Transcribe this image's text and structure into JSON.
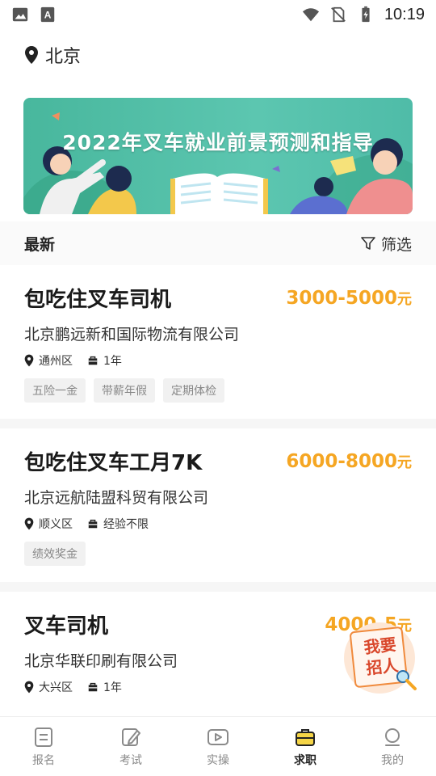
{
  "status_bar": {
    "time": "10:19",
    "icons": [
      "image-icon",
      "text-a-icon",
      "wifi-icon",
      "no-sim-icon",
      "battery-charging-icon"
    ]
  },
  "location": {
    "city": "北京",
    "icon": "location-pin-icon"
  },
  "banner": {
    "title": "2022年叉车就业前景预测和指导"
  },
  "feed": {
    "title": "最新",
    "filter_label": "筛选"
  },
  "jobs": [
    {
      "title": "包吃住叉车司机",
      "salary": "3000-5000",
      "unit": "元",
      "company": "北京鹏远新和国际物流有限公司",
      "district": "通州区",
      "experience": "1年",
      "tags": [
        "五险一金",
        "带薪年假",
        "定期体检"
      ]
    },
    {
      "title": "包吃住叉车工月7K",
      "salary": "6000-8000",
      "unit": "元",
      "company": "北京远航陆盟科贸有限公司",
      "district": "顺义区",
      "experience": "经验不限",
      "tags": [
        "绩效奖金"
      ]
    },
    {
      "title": "叉车司机",
      "salary": "4000-5",
      "unit": "元",
      "company": "北京华联印刷有限公司",
      "district": "大兴区",
      "experience": "1年",
      "tags": []
    }
  ],
  "fab": {
    "label_line1": "我要",
    "label_line2": "招人"
  },
  "tabs": [
    {
      "label": "报名",
      "icon": "form-icon"
    },
    {
      "label": "考试",
      "icon": "pencil-icon"
    },
    {
      "label": "实操",
      "icon": "play-icon"
    },
    {
      "label": "求职",
      "icon": "briefcase-icon"
    },
    {
      "label": "我的",
      "icon": "profile-icon"
    }
  ],
  "colors": {
    "accent": "#f5a623",
    "banner": "#5cc6b0",
    "fab_text": "#d9472b"
  }
}
